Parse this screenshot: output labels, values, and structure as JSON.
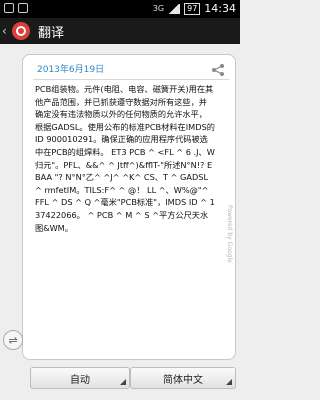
{
  "status_bar": {
    "network": "3G",
    "battery": "97",
    "time": "14:34"
  },
  "header": {
    "back_icon": "back-arrow",
    "title": "翻译"
  },
  "card": {
    "date": "2013年6月19日",
    "content": "PCB组装物。元件(电阻、电容、磁簧开关)用在其他产品范围，并已抓获遵守数据对所有这些，并确定没有违法物质以外的任何物质的允许水平，根据GADSL。使用公布的标准PCB材料在IMDS的ID 900010291。确保正确的应用程序代码被选中在PCB的组焊料。 ET3 PCB ^ <FL ^ 6 .J、W归元\"。PFL、&&^ ^ Jtff^)&fflT-\"所述N°N!? EBAA \"? N°N°乙^ ^J^ ^K^ CS、T ^ GADSL ^ rmfetIM。TILS:F^ ^ @！ LL ^、W%@\"^ FFL ^ DS ^ Q ^毫米\"PCB标准\"，IMDS ID ^ 137422066。 ^ PCB ^ M ^ S ^平方公尺天水图&WM。",
    "powered_by": "Powered by Google"
  },
  "footer": {
    "source_lang": "自动",
    "target_lang": "简体中文"
  }
}
